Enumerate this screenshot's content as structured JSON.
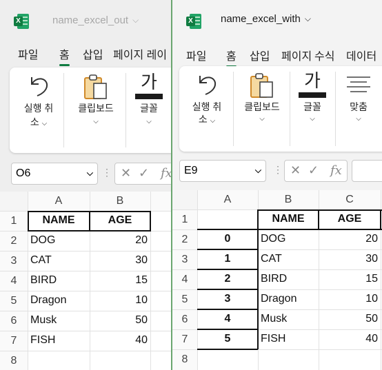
{
  "left_window": {
    "title": "name_excel_out",
    "ribbon_tabs": [
      "파일",
      "홈",
      "삽입",
      "페이지 레이"
    ],
    "active_tab": "홈",
    "ribbon": {
      "undo_line1": "실행 취",
      "undo_line2": "소",
      "clipboard": "클립보드",
      "font_glyph": "가",
      "font": "글꼴"
    },
    "name_box": "O6",
    "fx": "fx",
    "columns": [
      "A",
      "B"
    ],
    "rows": [
      "1",
      "2",
      "3",
      "4",
      "5",
      "6",
      "7",
      "8"
    ],
    "headers": [
      "NAME",
      "AGE"
    ],
    "data": [
      {
        "name": "DOG",
        "age": "20"
      },
      {
        "name": "CAT",
        "age": "30"
      },
      {
        "name": "BIRD",
        "age": "15"
      },
      {
        "name": "Dragon",
        "age": "10"
      },
      {
        "name": "Musk",
        "age": "50"
      },
      {
        "name": "FISH",
        "age": "40"
      }
    ]
  },
  "right_window": {
    "title": "name_excel_with",
    "ribbon_tabs": [
      "파일",
      "홈",
      "삽입",
      "페이지",
      "수식",
      "데이터"
    ],
    "active_tab": "홈",
    "ribbon": {
      "undo_line1": "실행 취",
      "undo_line2": "소",
      "clipboard": "클립보드",
      "font_glyph": "가",
      "font": "글꼴",
      "align": "맞춤"
    },
    "name_box": "E9",
    "fx": "fx",
    "columns": [
      "A",
      "B",
      "C"
    ],
    "rows": [
      "1",
      "2",
      "3",
      "4",
      "5",
      "6",
      "7",
      "8"
    ],
    "headers": [
      "NAME",
      "AGE"
    ],
    "index": [
      "0",
      "1",
      "2",
      "3",
      "4",
      "5"
    ],
    "data": [
      {
        "name": "DOG",
        "age": "20"
      },
      {
        "name": "CAT",
        "age": "30"
      },
      {
        "name": "BIRD",
        "age": "15"
      },
      {
        "name": "Dragon",
        "age": "10"
      },
      {
        "name": "Musk",
        "age": "50"
      },
      {
        "name": "FISH",
        "age": "40"
      }
    ]
  },
  "colors": {
    "excel_green": "#107c41",
    "tab_underline": "#107c41",
    "window_border": "#6aa66f"
  }
}
